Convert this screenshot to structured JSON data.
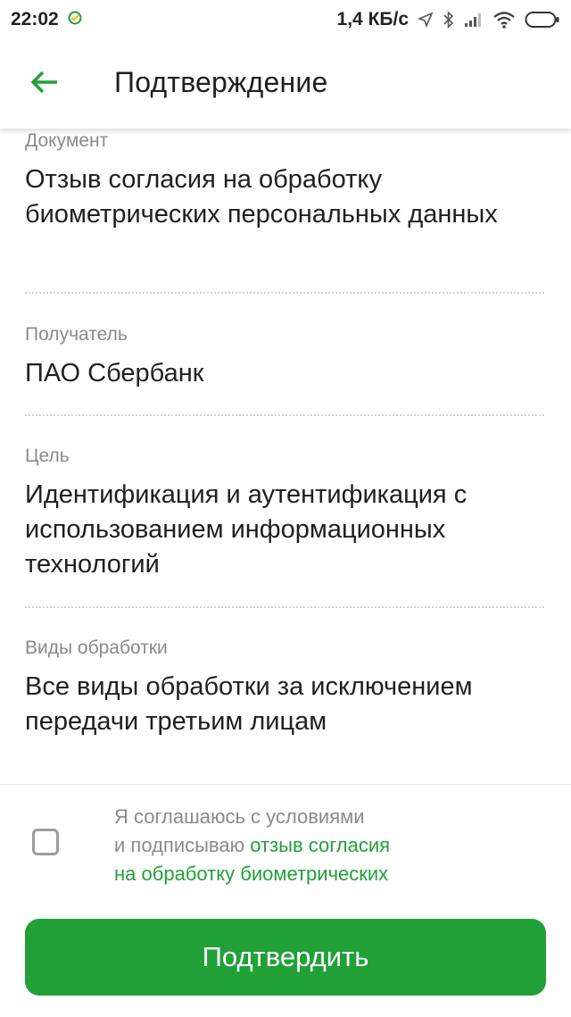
{
  "status_bar": {
    "time": "22:02",
    "network_speed": "1,4 КБ/с",
    "icons": [
      "sber-notification-icon",
      "location-arrow-icon",
      "bluetooth-icon",
      "signal-icon",
      "wifi-icon",
      "battery-icon"
    ]
  },
  "header": {
    "back_icon": "arrow-left-icon",
    "title": "Подтверждение"
  },
  "details": [
    {
      "label": "Документ",
      "value": "Отзыв согласия на обработку биометрических персональных данных"
    },
    {
      "label": "Получатель",
      "value": "ПАО Сбербанк"
    },
    {
      "label": "Цель",
      "value": "Идентификация и аутентификация с использованием информационных технологий"
    },
    {
      "label": "Виды обработки",
      "value": "Все виды обработки за исключением передачи третьим лицам"
    }
  ],
  "agreement": {
    "checked": false,
    "text_line1": "Я соглашаюсь с условиями",
    "text_line2_plain": "и подписываю",
    "link_part1": "отзыв согласия",
    "link_part2": "на обработку биометрических"
  },
  "confirm_button": {
    "label": "Подтвердить"
  },
  "colors": {
    "accent": "#21a038",
    "label_gray": "#8a8a8a",
    "text_dark": "#1f1f1f"
  }
}
